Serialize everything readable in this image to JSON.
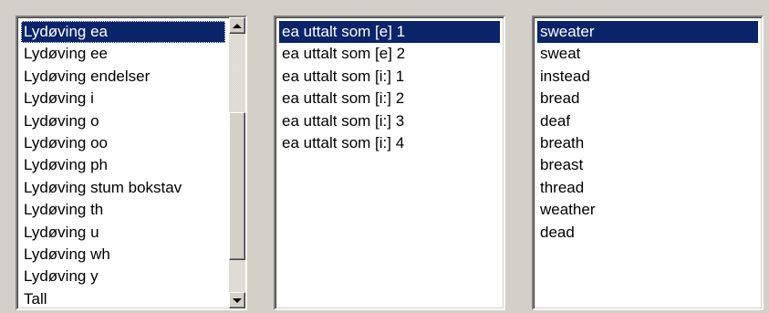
{
  "lists": {
    "categories": {
      "items": [
        "Lydøving ea",
        "Lydøving ee",
        "Lydøving endelser",
        "Lydøving i",
        "Lydøving o",
        "Lydøving oo",
        "Lydøving ph",
        "Lydøving stum bokstav",
        "Lydøving th",
        "Lydøving u",
        "Lydøving wh",
        "Lydøving y",
        "Tall"
      ],
      "selected": "Lydøving ea"
    },
    "exercises": {
      "items": [
        "ea uttalt som [e] 1",
        "ea uttalt som [e] 2",
        "ea uttalt som [i:] 1",
        "ea uttalt som [i:] 2",
        "ea uttalt som [i:] 3",
        "ea uttalt som [i:] 4"
      ],
      "selected": "ea uttalt som [e] 1"
    },
    "words": {
      "items": [
        "sweater",
        "sweat",
        "instead",
        "bread",
        "deaf",
        "breath",
        "breast",
        "thread",
        "weather",
        "dead"
      ],
      "selected": "sweater"
    }
  },
  "icons": {
    "scroll_up": "arrow-up-icon",
    "scroll_down": "arrow-down-icon"
  },
  "colors": {
    "selection_bg": "#0a246a",
    "selection_fg": "#ffffff",
    "window_bg": "#d4d0c8"
  }
}
